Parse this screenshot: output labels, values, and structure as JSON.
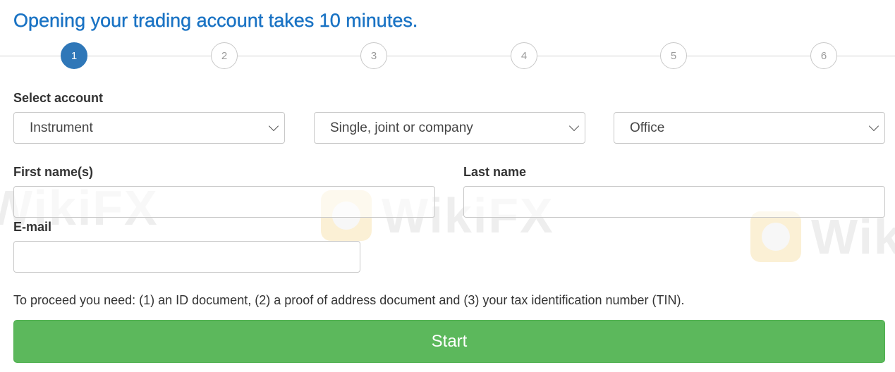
{
  "title": "Opening your trading account takes 10 minutes.",
  "steps": [
    "1",
    "2",
    "3",
    "4",
    "5",
    "6"
  ],
  "active_step": "1",
  "select_account": {
    "label": "Select account",
    "instrument": "Instrument",
    "holder_type": "Single, joint or company",
    "office": "Office"
  },
  "first_name": {
    "label": "First name(s)",
    "value": ""
  },
  "last_name": {
    "label": "Last name",
    "value": ""
  },
  "email": {
    "label": "E-mail",
    "value": ""
  },
  "requirements_note": "To proceed you need: (1) an ID document, (2) a proof of address document and (3) your tax identification number (TIN).",
  "start_button": "Start",
  "watermark": "WikiFX",
  "colors": {
    "title": "#1a73c4",
    "active_step": "#2f77b8",
    "start_button": "#5cb85c"
  }
}
